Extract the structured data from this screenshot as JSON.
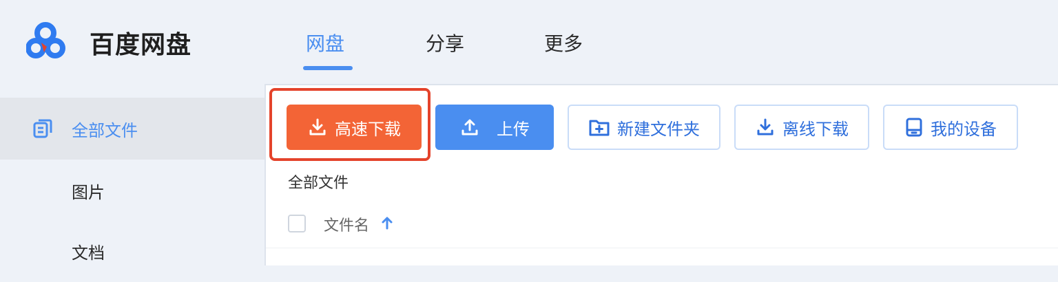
{
  "app": {
    "logo_text": "百度网盘"
  },
  "nav": {
    "tabs": [
      "网盘",
      "分享",
      "更多"
    ]
  },
  "sidebar": {
    "items": [
      "全部文件",
      "图片",
      "文档"
    ]
  },
  "toolbar": {
    "fast_download": "高速下载",
    "upload": "上传",
    "new_folder": "新建文件夹",
    "offline_download": "离线下载",
    "my_devices": "我的设备"
  },
  "breadcrumb": "全部文件",
  "file_list": {
    "column_name": "文件名"
  },
  "colors": {
    "accent": "#4a8ef0",
    "fast_download_bg": "#f36436",
    "highlight": "#e4432b"
  },
  "icons": {
    "logo": "baidu-cloud-logo",
    "sidebar_all_files": "files-icon",
    "fast_download": "download-icon",
    "upload": "upload-icon",
    "new_folder": "folder-plus-icon",
    "offline_download": "download-icon",
    "my_devices": "device-icon",
    "sort": "arrow-up-icon"
  }
}
